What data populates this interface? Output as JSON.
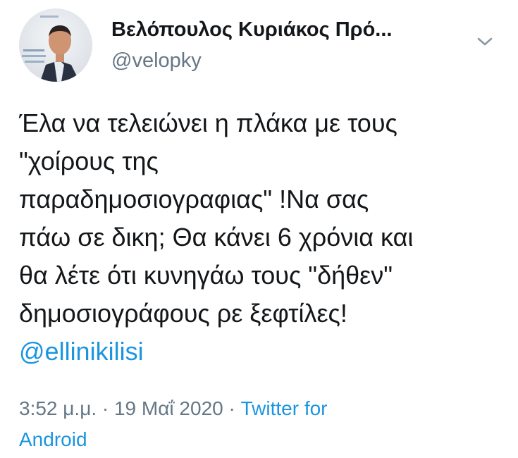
{
  "author": {
    "display_name": "Βελόπουλος Κυριάκος Πρό...",
    "handle": "@velopky"
  },
  "icons": {
    "avatar": "profile-photo",
    "more": "chevron-down-icon"
  },
  "tweet": {
    "lines": [
      "Έλα να τελειώνει η πλάκα με τους",
      "\"χοίρους της",
      "παραδημοσιογραφιας\" !Να σας",
      "πάω σε δικη; Θα κάνει 6 χρόνια και",
      "θα λέτε ότι κυνηγάω τους \"δήθεν\"",
      "δημοσιογράφους ρε ξεφτίλες!"
    ],
    "mention": "@ellinikilisi"
  },
  "meta": {
    "time_date": "3:52 μ.μ. · 19 Μαΐ 2020 · ",
    "source_line1": "Twitter for",
    "source_line2": "Android"
  },
  "colors": {
    "text": "#14171a",
    "secondary": "#657786",
    "link": "#1b95e0"
  }
}
